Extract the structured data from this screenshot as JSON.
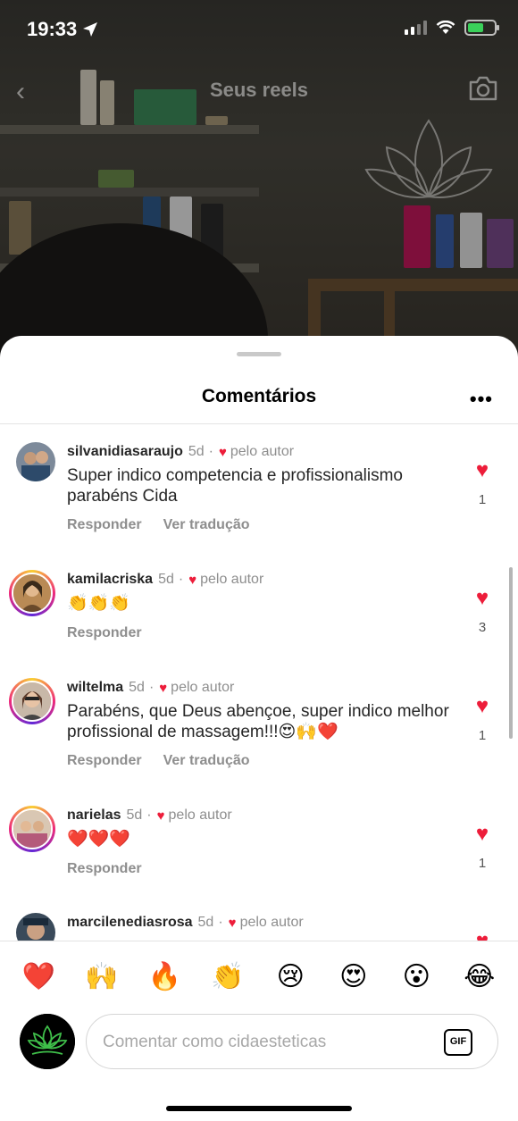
{
  "status_bar": {
    "time": "19:33",
    "battery_color": "#3ad05a"
  },
  "reel_header": {
    "title": "Seus reels",
    "back_icon": "chevron-left-icon",
    "camera_icon": "camera-icon"
  },
  "sheet": {
    "title": "Comentários",
    "more_label": "•••"
  },
  "author_heart_label": "pelo autor",
  "comments": [
    {
      "user": "silvanidiasaraujo",
      "time": "5d",
      "separator": "·",
      "text": "Super indico competencia  e profissionalismo parabéns Cida",
      "actions": [
        "Responder",
        "Ver tradução"
      ],
      "likes": "1"
    },
    {
      "user": "kamilacriska",
      "time": "5d",
      "separator": "·",
      "text": "👏👏👏",
      "actions": [
        "Responder"
      ],
      "likes": "3"
    },
    {
      "user": "wiltelma",
      "time": "5d",
      "separator": "·",
      "text": "Parabéns, que Deus abençoe, super indico melhor profissional de massagem!!!😍🙌❤️",
      "actions": [
        "Responder",
        "Ver tradução"
      ],
      "likes": "1"
    },
    {
      "user": "narielas",
      "time": "5d",
      "separator": "·",
      "text": "❤️❤️❤️",
      "actions": [
        "Responder"
      ],
      "likes": "1"
    },
    {
      "user": "marcilenediasrosa",
      "time": "5d",
      "separator": "·",
      "text": "",
      "actions": [],
      "likes": ""
    }
  ],
  "emoji_bar": [
    "❤️",
    "🙌",
    "🔥",
    "👏",
    "😢",
    "😍",
    "😮",
    "😂"
  ],
  "composer": {
    "placeholder": "Comentar como cidaesteticas",
    "gif_label": "GIF"
  },
  "colors": {
    "like_heart": "#ed1d3a",
    "muted_text": "#8e8e8e"
  }
}
